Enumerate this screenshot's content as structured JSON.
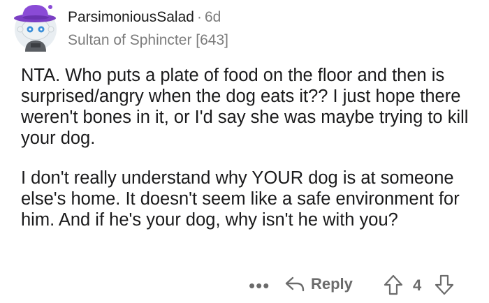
{
  "comment": {
    "username": "ParsimoniousSalad",
    "separator": "·",
    "age": "6d",
    "flair": "Sultan of Sphincter [643]",
    "paragraphs": [
      "NTA. Who puts a plate of food on the floor and then is surprised/angry when the dog eats it?? I just hope there weren't bones in it, or I'd say she was maybe trying to kill your dog.",
      "I don't really understand why YOUR dog is at someone else's home. It doesn't seem like a safe environment for him. And if he's your dog, why isn't he with you?"
    ]
  },
  "actions": {
    "more_label": "•••",
    "reply_label": "Reply",
    "score": "4"
  },
  "icons": {
    "avatar": "snoo-avatar-purple-hat",
    "reply": "reply-arrow-icon",
    "upvote": "upvote-arrow-icon",
    "downvote": "downvote-arrow-icon"
  },
  "colors": {
    "hat": "#7b3fc4",
    "meta_text": "#7c7c7c",
    "action_text": "#6b6b6b"
  }
}
